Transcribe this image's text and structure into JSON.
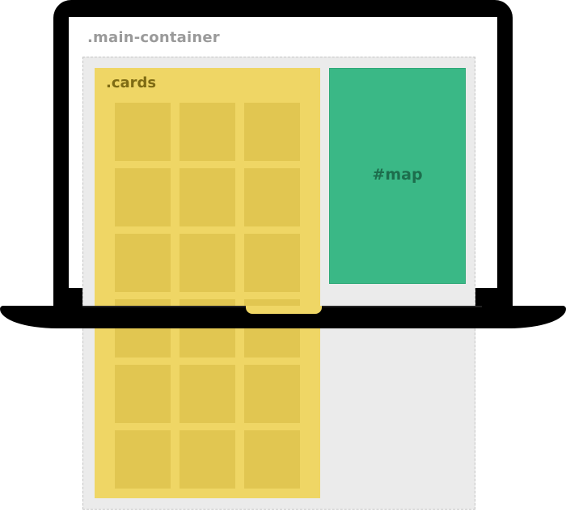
{
  "diagram": {
    "container_label": ".main-container",
    "cards_label": ".cards",
    "map_label": "#map",
    "card_grid": {
      "columns": 3,
      "rows": 6
    },
    "colors": {
      "laptop": "#000000",
      "container_bg": "#ebebeb",
      "container_border": "#c4c4c4",
      "cards_bg": "#efd665",
      "card_tile": "#e1c651",
      "map_bg": "#3ab886",
      "map_text": "#1d6e4d",
      "cards_text": "#7e6b14",
      "container_text": "#9a9a9a"
    }
  }
}
